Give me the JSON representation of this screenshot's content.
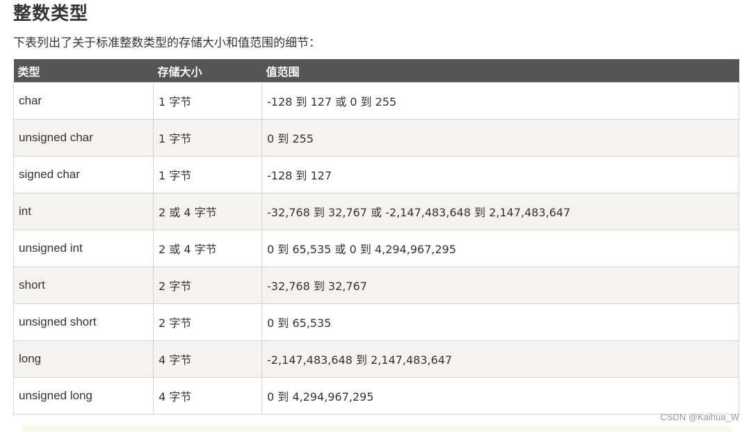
{
  "page": {
    "title": "整数类型",
    "intro": "下表列出了关于标准整数类型的存储大小和值范围的细节："
  },
  "table": {
    "headers": [
      "类型",
      "存储大小",
      "值范围"
    ],
    "rows": [
      {
        "type": "char",
        "size": "1 字节",
        "range": "-128 到 127 或 0 到 255"
      },
      {
        "type": "unsigned char",
        "size": "1 字节",
        "range": "0 到 255"
      },
      {
        "type": "signed char",
        "size": "1 字节",
        "range": "-128 到 127"
      },
      {
        "type": "int",
        "size": "2 或 4 字节",
        "range": "-32,768 到 32,767 或 -2,147,483,648 到 2,147,483,647"
      },
      {
        "type": "unsigned int",
        "size": "2 或 4 字节",
        "range": "0 到 65,535 或 0 到 4,294,967,295"
      },
      {
        "type": "short",
        "size": "2 字节",
        "range": "-32,768 到 32,767"
      },
      {
        "type": "unsigned short",
        "size": "2 字节",
        "range": "0 到 65,535"
      },
      {
        "type": "long",
        "size": "4 字节",
        "range": "-2,147,483,648 到 2,147,483,647"
      },
      {
        "type": "unsigned long",
        "size": "4 字节",
        "range": "0 到 4,294,967,295"
      }
    ]
  },
  "watermark": "CSDN @Kaihua_W",
  "colors": {
    "header_bg": "#555555",
    "header_text": "#ffffff",
    "stripe_bg": "#f4f3f0",
    "border": "#d4d4d4",
    "text": "#333333"
  }
}
